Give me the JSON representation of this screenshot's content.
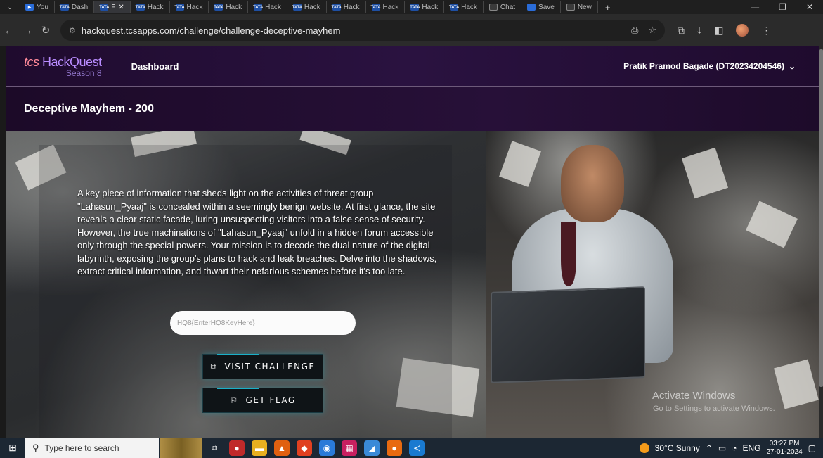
{
  "browser": {
    "tabs": [
      {
        "label": "You",
        "icon": "youtube-icon"
      },
      {
        "label": "Dash",
        "icon": "tata-icon"
      },
      {
        "label": "F",
        "icon": "tata-icon",
        "active": true
      },
      {
        "label": "Hack",
        "icon": "tata-icon"
      },
      {
        "label": "Hack",
        "icon": "tata-icon"
      },
      {
        "label": "Hack",
        "icon": "tata-icon"
      },
      {
        "label": "Hack",
        "icon": "tata-icon"
      },
      {
        "label": "Hack",
        "icon": "tata-icon"
      },
      {
        "label": "Hack",
        "icon": "tata-icon"
      },
      {
        "label": "Hack",
        "icon": "tata-icon"
      },
      {
        "label": "Hack",
        "icon": "tata-icon"
      },
      {
        "label": "Hack",
        "icon": "tata-icon"
      },
      {
        "label": "Chat",
        "icon": "chat-icon"
      },
      {
        "label": "Save",
        "icon": "save-icon"
      },
      {
        "label": "New",
        "icon": "new-icon"
      }
    ],
    "url": "hackquest.tcsapps.com/challenge/challenge-deceptive-mayhem"
  },
  "header": {
    "logo_brand": "tcs",
    "logo_name": "HackQuest",
    "logo_season": "Season 8",
    "nav_dashboard": "Dashboard",
    "user": "Pratik Pramod Bagade (DT20234204546)"
  },
  "challenge": {
    "title": "Deceptive Mayhem - 200",
    "description": "A key piece of information that sheds light on the activities of threat group \"Lahasun_Pyaaj\" is concealed within a seemingly benign website. At first glance, the site reveals a clear static facade, luring unsuspecting visitors into a false sense of security. However, the true machinations of \"Lahasun_Pyaaj\" unfold in a hidden forum accessible only through the special powers. Your mission is to decode the dual nature of the digital labyrinth, exposing the group's plans to hack and leak breaches. Delve into the shadows, extract critical information, and thwart their nefarious schemes before it's too late.",
    "flag_placeholder": "HQ8{EnterHQ8KeyHere}",
    "visit_button": "VISIT CHALLENGE",
    "getflag_button": "GET FLAG"
  },
  "watermark": {
    "title": "Activate Windows",
    "subtitle": "Go to Settings to activate Windows."
  },
  "taskbar": {
    "search_placeholder": "Type here to search",
    "weather": "30°C  Sunny",
    "language": "ENG",
    "time": "03:27 PM",
    "date": "27-01-2024"
  },
  "colors": {
    "header_bg": "#2a1240",
    "accent": "#1ab0c8",
    "taskbar": "#1c2733"
  }
}
